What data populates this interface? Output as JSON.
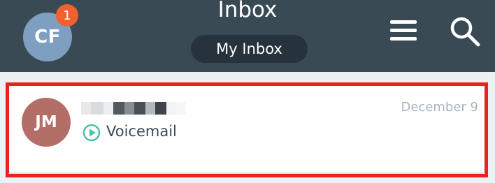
{
  "header": {
    "title": "Inbox",
    "user_initials": "CF",
    "notification_count": "1",
    "inbox_selector": "My Inbox",
    "menu_icon": "hamburger-menu-icon",
    "search_icon": "search-icon"
  },
  "messages": [
    {
      "initials": "JM",
      "date": "December 9",
      "type_label": "Voicemail",
      "type_icon": "play-circle-icon"
    }
  ],
  "colors": {
    "header_bg": "#3a4a55",
    "badge": "#f0612d",
    "user_avatar": "#7f9fc0",
    "contact_avatar": "#b36e68",
    "accent": "#4fc3a1",
    "highlight": "#e8231b"
  }
}
